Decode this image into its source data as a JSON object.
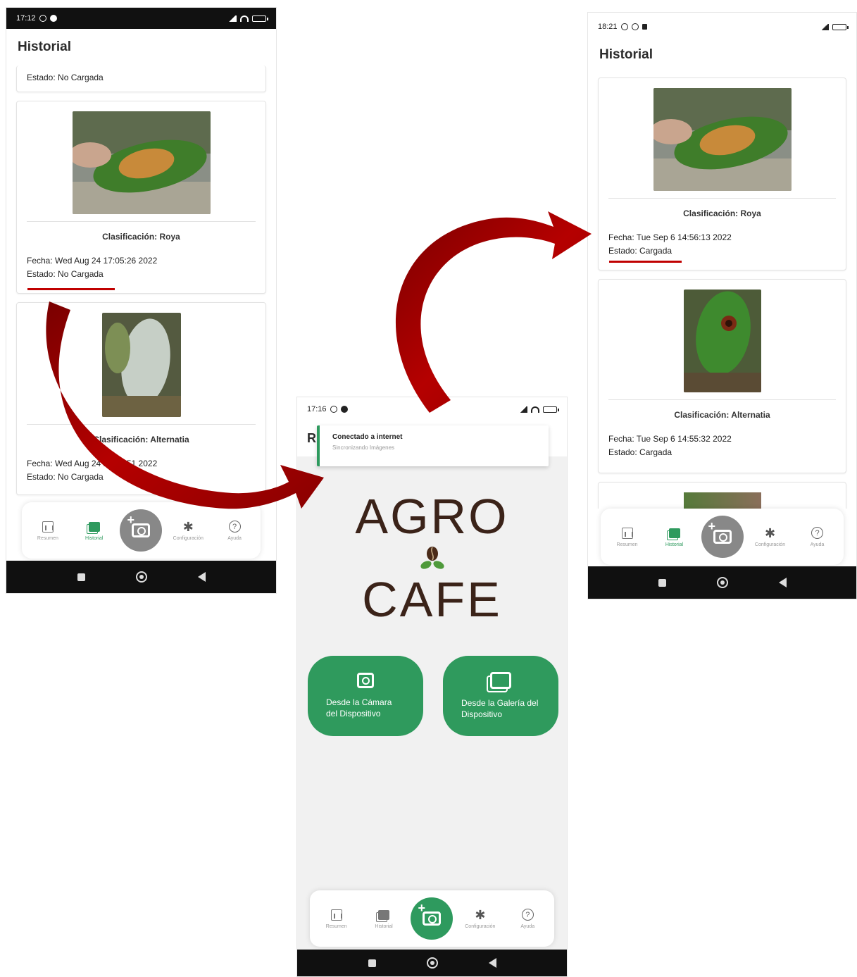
{
  "left_screen": {
    "status_time": "17:12",
    "title": "Historial",
    "partial_card_status": "Estado: No Cargada",
    "cards": [
      {
        "classification": "Clasificación: Roya",
        "date": "Fecha: Wed Aug 24 17:05:26 2022",
        "status": "Estado: No Cargada"
      },
      {
        "classification": "Clasificación: Alternatia",
        "date": "Fecha: Wed Aug 24 17:03:51 2022",
        "status": "Estado: No Cargada"
      }
    ]
  },
  "middle_screen": {
    "status_time": "17:16",
    "header_partial": "R",
    "toast_title": "Conectado a internet",
    "toast_subtitle": "Sincronizando Imágenes",
    "logo_line1": "AGRO",
    "logo_line2": "CAFE",
    "button_camera": "Desde la Cámara del Dispositivo",
    "button_gallery": "Desde la Galería del Dispositivo"
  },
  "right_screen": {
    "status_time": "18:21",
    "title": "Historial",
    "cards": [
      {
        "classification": "Clasificación: Roya",
        "date": "Fecha: Tue Sep  6 14:56:13 2022",
        "status": "Estado: Cargada"
      },
      {
        "classification": "Clasificación: Alternatia",
        "date": "Fecha: Tue Sep  6 14:55:32 2022",
        "status": "Estado: Cargada"
      }
    ]
  },
  "nav": {
    "resumen": "Resumen",
    "historial": "Historial",
    "configuracion": "Configuración",
    "ayuda": "Ayuda"
  },
  "colors": {
    "accent_green": "#2e9a5e",
    "arrow_red": "#9b0000",
    "underline_red": "#c00000"
  },
  "icons": [
    "camera-icon",
    "gallery-icon",
    "chart-icon",
    "gear-icon",
    "help-icon",
    "square-nav-icon",
    "home-nav-icon",
    "back-nav-icon"
  ]
}
